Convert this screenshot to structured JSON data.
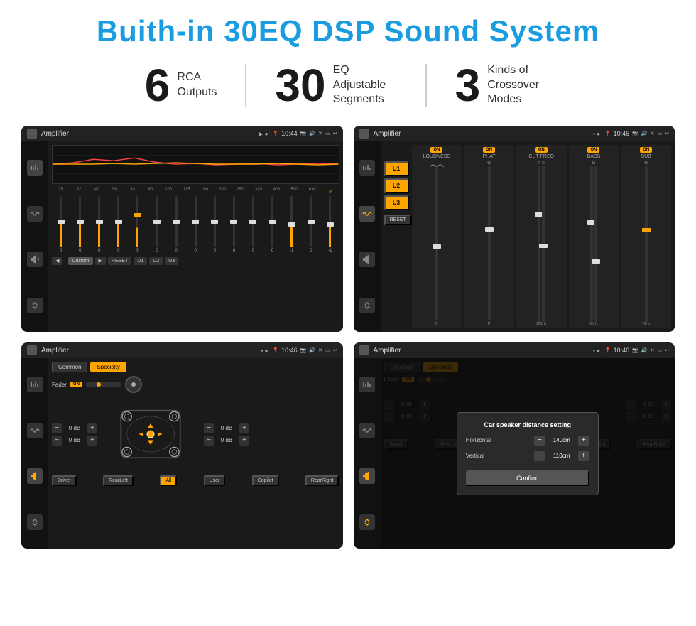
{
  "page": {
    "title": "Buith-in 30EQ DSP Sound System",
    "stats": [
      {
        "number": "6",
        "label": "RCA\nOutputs"
      },
      {
        "number": "30",
        "label": "EQ Adjustable\nSegments"
      },
      {
        "number": "3",
        "label": "Kinds of\nCrossover Modes"
      }
    ],
    "screens": [
      {
        "id": "screen1",
        "app_name": "Amplifier",
        "time": "10:44",
        "type": "eq"
      },
      {
        "id": "screen2",
        "app_name": "Amplifier",
        "time": "10:45",
        "type": "crossover"
      },
      {
        "id": "screen3",
        "app_name": "Amplifier",
        "time": "10:46",
        "type": "speaker"
      },
      {
        "id": "screen4",
        "app_name": "Amplifier",
        "time": "10:46",
        "type": "dialog"
      }
    ],
    "eq": {
      "freqs": [
        "25",
        "32",
        "40",
        "50",
        "63",
        "80",
        "100",
        "125",
        "160",
        "200",
        "250",
        "320",
        "400",
        "500",
        "630"
      ],
      "values": [
        "0",
        "0",
        "0",
        "0",
        "5",
        "0",
        "0",
        "0",
        "0",
        "0",
        "0",
        "0",
        "-1",
        "0",
        "-1"
      ],
      "preset": "Custom",
      "buttons": [
        "RESET",
        "U1",
        "U2",
        "U3"
      ]
    },
    "crossover": {
      "u_buttons": [
        "U1",
        "U2",
        "U3"
      ],
      "columns": [
        "LOUDNESS",
        "PHAT",
        "CUT FREQ",
        "BASS",
        "SUB"
      ],
      "reset": "RESET"
    },
    "speaker": {
      "tabs": [
        "Common",
        "Specialty"
      ],
      "fader": "Fader",
      "on_label": "ON",
      "vol_values": [
        "0 dB",
        "0 dB",
        "0 dB",
        "0 dB"
      ],
      "bottom_buttons": [
        "Driver",
        "RearLeft",
        "All",
        "User",
        "Copilot",
        "RearRight"
      ]
    },
    "dialog": {
      "title": "Car speaker distance setting",
      "horizontal_label": "Horizontal",
      "horizontal_value": "140cm",
      "vertical_label": "Vertical",
      "vertical_value": "110cm",
      "confirm_label": "Confirm"
    }
  }
}
